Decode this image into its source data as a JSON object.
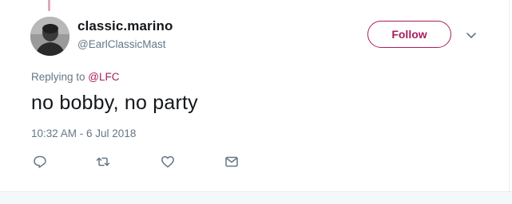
{
  "tweet": {
    "user": {
      "display_name": "classic.marino",
      "handle": "@EarlClassicMast"
    },
    "follow_label": "Follow",
    "replying_prefix": "Replying to ",
    "replying_to": "@LFC",
    "text": "no bobby, no party",
    "timestamp": "10:32 AM - 6 Jul 2018"
  },
  "icons": {
    "caret": "chevron-down-icon",
    "reply": "reply-icon",
    "retweet": "retweet-icon",
    "like": "heart-icon",
    "message": "envelope-icon"
  },
  "colors": {
    "accent": "#a71e5b",
    "secondary_text": "#657786",
    "primary_text": "#14171a",
    "icon": "#657786"
  }
}
